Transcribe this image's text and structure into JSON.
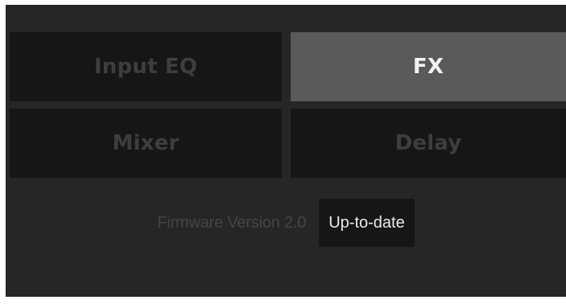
{
  "tiles": {
    "input_eq": {
      "label": "Input EQ",
      "state": "inactive"
    },
    "fx": {
      "label": "FX",
      "state": "selected"
    },
    "mixer": {
      "label": "Mixer",
      "state": "inactive"
    },
    "delay": {
      "label": "Delay",
      "state": "inactive"
    }
  },
  "firmware": {
    "label": "Firmware Version 2.0",
    "button_label": "Up-to-date"
  },
  "colors": {
    "panel_background": "#262626",
    "tile_inactive": "#161616",
    "tile_selected": "#5a5a5a",
    "text_dim": "#3e3e3e",
    "text_bright": "#f2f2f2"
  }
}
